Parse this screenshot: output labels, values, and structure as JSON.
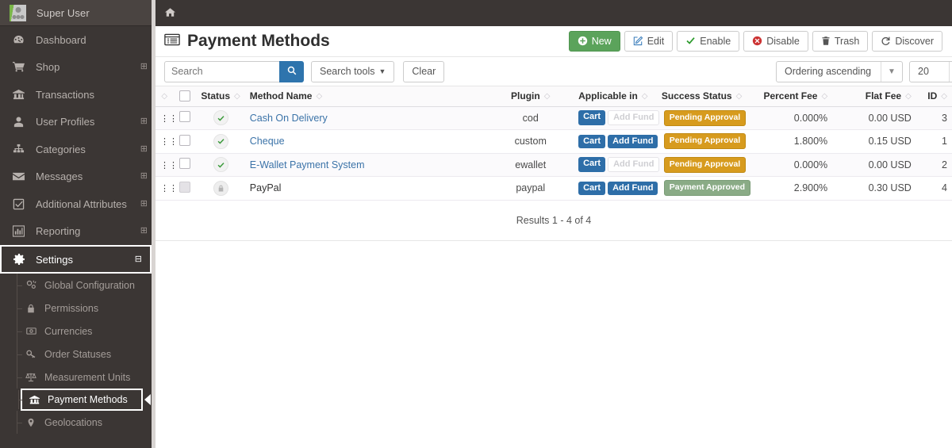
{
  "sidebar": {
    "user": {
      "name": "Super User",
      "avatar_icon": "user-avatar-icon"
    },
    "items": [
      {
        "label": "Dashboard",
        "icon": "dashboard-icon",
        "expander": ""
      },
      {
        "label": "Shop",
        "icon": "cart-icon",
        "expander": "⊞"
      },
      {
        "label": "Transactions",
        "icon": "bank-icon",
        "expander": ""
      },
      {
        "label": "User Profiles",
        "icon": "user-icon",
        "expander": "⊞"
      },
      {
        "label": "Categories",
        "icon": "sitemap-icon",
        "expander": "⊞"
      },
      {
        "label": "Messages",
        "icon": "envelope-icon",
        "expander": "⊞"
      },
      {
        "label": "Additional Attributes",
        "icon": "checkbox-icon",
        "expander": "⊞"
      },
      {
        "label": "Reporting",
        "icon": "bar-chart-icon",
        "expander": "⊞"
      },
      {
        "label": "Settings",
        "icon": "gear-icon",
        "expander": "⊟"
      }
    ],
    "settings_children": [
      {
        "label": "Global Configuration",
        "icon": "sliders-icon"
      },
      {
        "label": "Permissions",
        "icon": "lock-icon"
      },
      {
        "label": "Currencies",
        "icon": "money-icon"
      },
      {
        "label": "Order Statuses",
        "icon": "key-icon"
      },
      {
        "label": "Measurement Units",
        "icon": "scale-icon"
      },
      {
        "label": "Payment Methods",
        "icon": "bank-icon"
      },
      {
        "label": "Geolocations",
        "icon": "map-marker-icon"
      }
    ],
    "selected_child": "Payment Methods",
    "active_parent": "Settings"
  },
  "topbar": {
    "home_icon": "home-icon"
  },
  "page": {
    "title": "Payment Methods",
    "title_icon": "list-alt-icon"
  },
  "toolbar": {
    "buttons": [
      {
        "label": "New",
        "icon": "plus-circle-icon",
        "style": "primary"
      },
      {
        "label": "Edit",
        "icon": "pencil-square-icon",
        "style": "default"
      },
      {
        "label": "Enable",
        "icon": "check-icon",
        "style": "default"
      },
      {
        "label": "Disable",
        "icon": "times-circle-icon",
        "style": "default"
      },
      {
        "label": "Trash",
        "icon": "trash-icon",
        "style": "default"
      },
      {
        "label": "Discover",
        "icon": "refresh-icon",
        "style": "default"
      }
    ]
  },
  "filters": {
    "search_placeholder": "Search",
    "search_value": "",
    "search_button_icon": "search-icon",
    "search_tools_label": "Search tools",
    "clear_label": "Clear",
    "ordering_value": "Ordering ascending",
    "page_size_value": "20"
  },
  "table": {
    "columns": [
      {
        "label": "",
        "key": "drag",
        "sortable": true
      },
      {
        "label": "",
        "key": "checkbox",
        "sortable": false
      },
      {
        "label": "Status",
        "key": "status",
        "sortable": true
      },
      {
        "label": "Method Name",
        "key": "name",
        "sortable": true
      },
      {
        "label": "Plugin",
        "key": "plugin",
        "sortable": true
      },
      {
        "label": "Applicable in",
        "key": "applicable",
        "sortable": true
      },
      {
        "label": "Success Status",
        "key": "success",
        "sortable": true
      },
      {
        "label": "Percent Fee",
        "key": "percent",
        "sortable": true
      },
      {
        "label": "Flat Fee",
        "key": "flat",
        "sortable": true
      },
      {
        "label": "ID",
        "key": "id",
        "sortable": true
      }
    ],
    "rows": [
      {
        "status_icon": "check-circle-icon",
        "status_state": "enabled",
        "checkbox_disabled": false,
        "name": "Cash On Delivery",
        "name_is_link": true,
        "plugin": "cod",
        "applicable": [
          {
            "label": "Cart",
            "active": true
          },
          {
            "label": "Add Fund",
            "active": false
          }
        ],
        "success_status": "Pending Approval",
        "success_state": "pending",
        "percent_fee": "0.000%",
        "flat_fee": "0.00 USD",
        "id": "3"
      },
      {
        "status_icon": "check-circle-icon",
        "status_state": "enabled",
        "checkbox_disabled": false,
        "name": "Cheque",
        "name_is_link": true,
        "plugin": "custom",
        "applicable": [
          {
            "label": "Cart",
            "active": true
          },
          {
            "label": "Add Fund",
            "active": true
          }
        ],
        "success_status": "Pending Approval",
        "success_state": "pending",
        "percent_fee": "1.800%",
        "flat_fee": "0.15 USD",
        "id": "1"
      },
      {
        "status_icon": "check-circle-icon",
        "status_state": "enabled",
        "checkbox_disabled": false,
        "name": "E-Wallet Payment System",
        "name_is_link": true,
        "plugin": "ewallet",
        "applicable": [
          {
            "label": "Cart",
            "active": true
          },
          {
            "label": "Add Fund",
            "active": false
          }
        ],
        "success_status": "Pending Approval",
        "success_state": "pending",
        "percent_fee": "0.000%",
        "flat_fee": "0.00 USD",
        "id": "2"
      },
      {
        "status_icon": "lock-icon",
        "status_state": "locked",
        "checkbox_disabled": true,
        "name": "PayPal",
        "name_is_link": false,
        "plugin": "paypal",
        "applicable": [
          {
            "label": "Cart",
            "active": true
          },
          {
            "label": "Add Fund",
            "active": true
          }
        ],
        "success_status": "Payment Approved",
        "success_state": "approved",
        "percent_fee": "2.900%",
        "flat_fee": "0.30 USD",
        "id": "4"
      }
    ],
    "results_text": "Results 1 - 4 of 4"
  },
  "colors": {
    "sidebar_bg": "#3b3634",
    "primary_green": "#5ba35b",
    "search_blue": "#2e74ad",
    "pill_blue": "#2e6ea8",
    "badge_pending": "#d79b1e",
    "badge_approved": "#8aab86",
    "link_blue": "#3b73a8"
  }
}
